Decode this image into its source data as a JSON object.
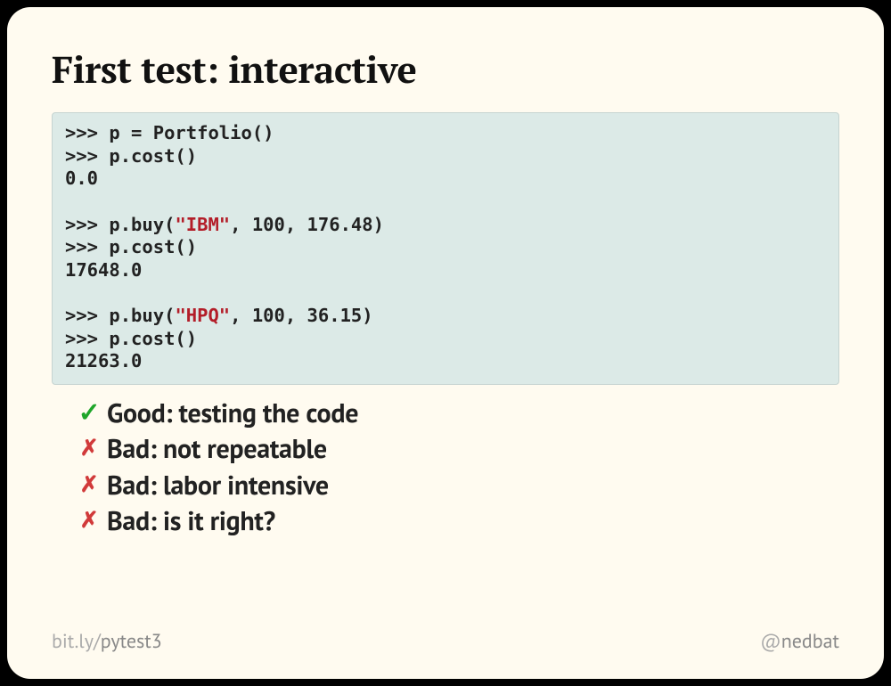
{
  "title": "First test: interactive",
  "code": {
    "lines": [
      {
        "p": ">>> ",
        "t": "p = Portfolio()"
      },
      {
        "p": ">>> ",
        "t": "p.cost()"
      },
      {
        "p": "",
        "t": "0.0"
      },
      {
        "p": "",
        "t": ""
      },
      {
        "p": ">>> ",
        "t_pre": "p.buy(",
        "str": "\"IBM\"",
        "t_post": ", 100, 176.48)"
      },
      {
        "p": ">>> ",
        "t": "p.cost()"
      },
      {
        "p": "",
        "t": "17648.0"
      },
      {
        "p": "",
        "t": ""
      },
      {
        "p": ">>> ",
        "t_pre": "p.buy(",
        "str": "\"HPQ\"",
        "t_post": ", 100, 36.15)"
      },
      {
        "p": ">>> ",
        "t": "p.cost()"
      },
      {
        "p": "",
        "t": "21263.0"
      }
    ]
  },
  "bullets": [
    {
      "kind": "good",
      "mark": "✓",
      "text": "Good: testing the code"
    },
    {
      "kind": "bad",
      "mark": "✗",
      "text": "Bad: not repeatable"
    },
    {
      "kind": "bad",
      "mark": "✗",
      "text": "Bad: labor intensive"
    },
    {
      "kind": "bad",
      "mark": "✗",
      "text": "Bad: is it right?"
    }
  ],
  "footer": {
    "left_prefix": "bit.ly/",
    "left_main": "pytest3",
    "right_prefix": "@",
    "right_main": "nedbat"
  }
}
